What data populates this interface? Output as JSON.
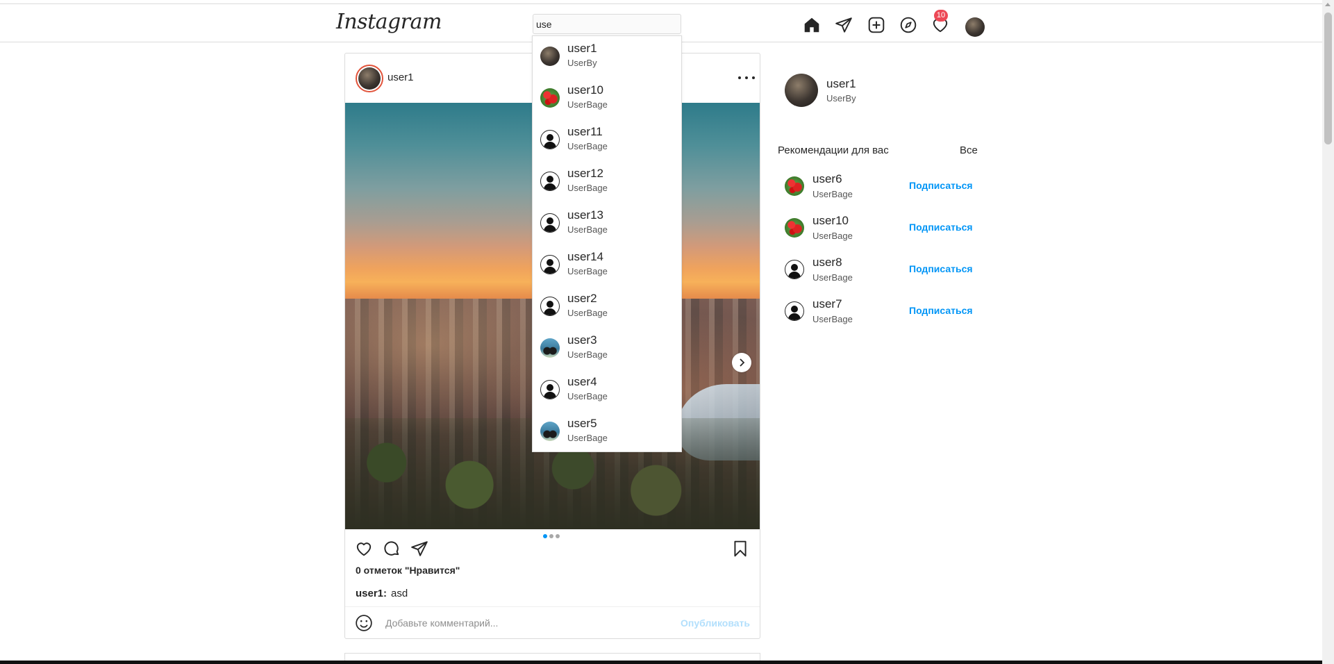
{
  "header": {
    "logo": "Instagram",
    "search_value": "use",
    "notifications_count": "10"
  },
  "nav_icons": [
    "home-icon",
    "send-icon",
    "new-post-icon",
    "explore-icon",
    "heart-icon",
    "profile-avatar"
  ],
  "search_results": [
    {
      "name": "user1",
      "sub": "UserBy",
      "avatar": "photo"
    },
    {
      "name": "user10",
      "sub": "UserBage",
      "avatar": "berries"
    },
    {
      "name": "user11",
      "sub": "UserBage",
      "avatar": "default"
    },
    {
      "name": "user12",
      "sub": "UserBage",
      "avatar": "default"
    },
    {
      "name": "user13",
      "sub": "UserBage",
      "avatar": "default"
    },
    {
      "name": "user14",
      "sub": "UserBage",
      "avatar": "default"
    },
    {
      "name": "user2",
      "sub": "UserBage",
      "avatar": "default"
    },
    {
      "name": "user3",
      "sub": "UserBage",
      "avatar": "couple"
    },
    {
      "name": "user4",
      "sub": "UserBage",
      "avatar": "default"
    },
    {
      "name": "user5",
      "sub": "UserBage",
      "avatar": "couple"
    }
  ],
  "post": {
    "username": "user1",
    "likes": "0 отметок  \"Нравится\"",
    "caption_user": "user1:",
    "caption_text": "asd",
    "comment_placeholder": "Добавьте комментарий...",
    "publish_label": "Опубликовать",
    "carousel_count": 3,
    "carousel_active": 1
  },
  "sidebar": {
    "profile_name": "user1",
    "profile_sub": "UserBy",
    "rec_title": "Рекомендации для вас",
    "rec_all": "Все",
    "follow_label": "Подписаться",
    "recommendations": [
      {
        "name": "user6",
        "sub": "UserBage",
        "avatar": "berries"
      },
      {
        "name": "user10",
        "sub": "UserBage",
        "avatar": "berries"
      },
      {
        "name": "user8",
        "sub": "UserBage",
        "avatar": "default"
      },
      {
        "name": "user7",
        "sub": "UserBage",
        "avatar": "default"
      }
    ]
  },
  "colors": {
    "accent_blue": "#0095f6",
    "publish_disabled": "#b2dffc",
    "badge_red": "#ed4956",
    "border": "#dbdbdb"
  }
}
